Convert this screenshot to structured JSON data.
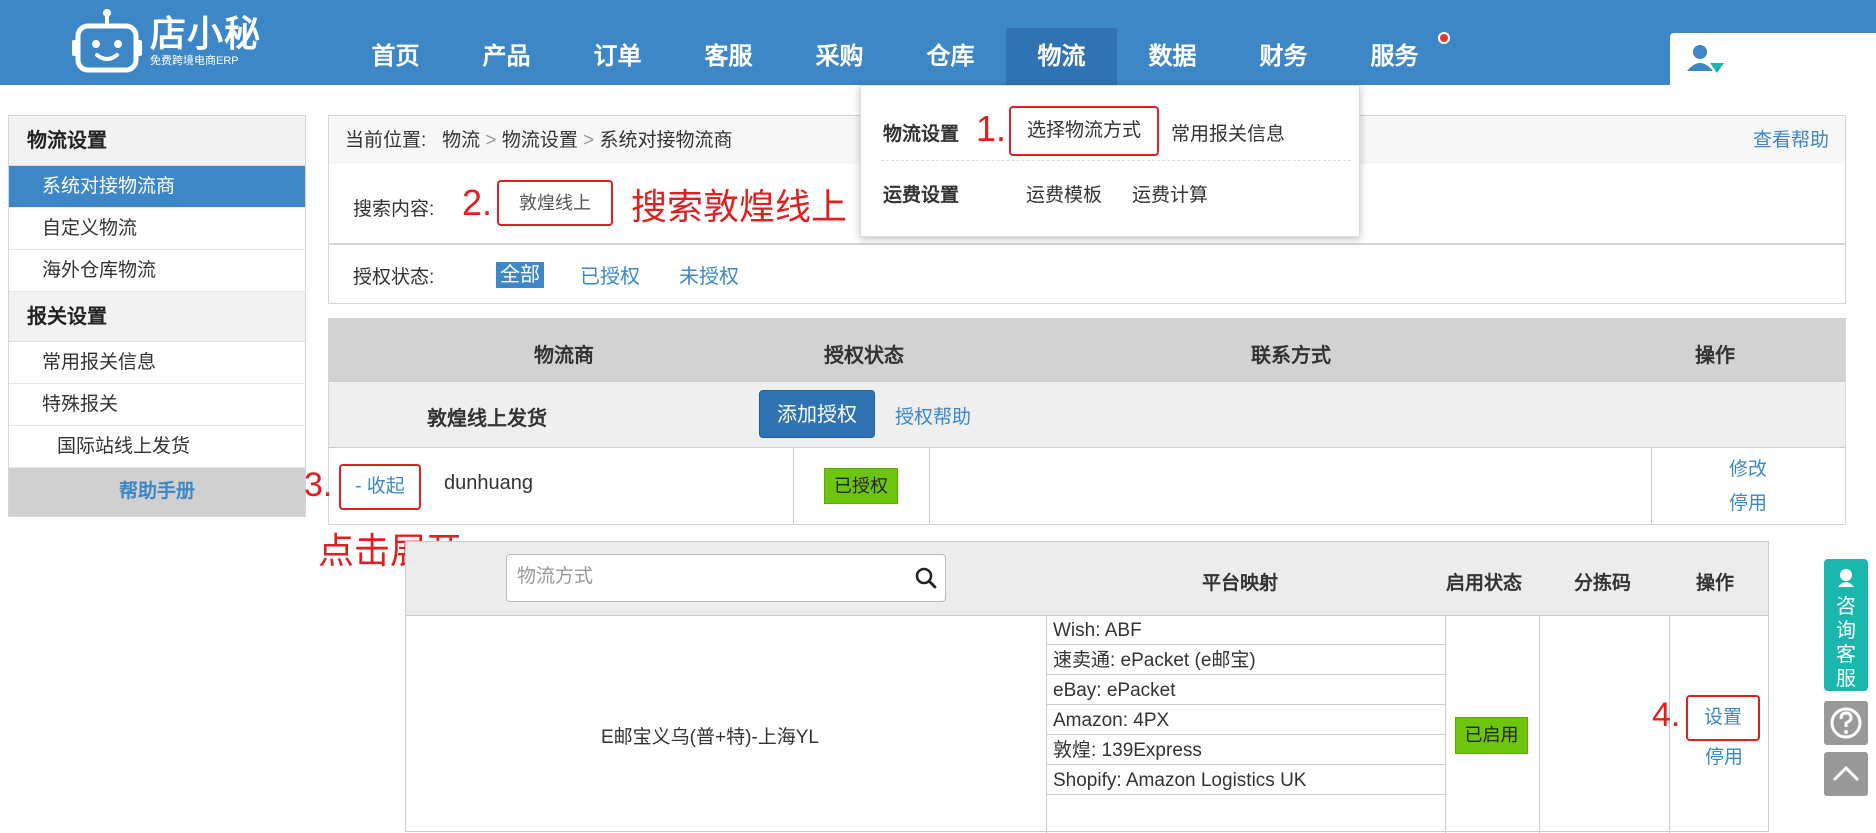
{
  "brand": {
    "name": "店小秘",
    "subtitle": "免费跨境电商ERP"
  },
  "nav": [
    {
      "label": "首页"
    },
    {
      "label": "产品"
    },
    {
      "label": "订单"
    },
    {
      "label": "客服"
    },
    {
      "label": "采购"
    },
    {
      "label": "仓库"
    },
    {
      "label": "物流"
    },
    {
      "label": "数据"
    },
    {
      "label": "财务"
    },
    {
      "label": "服务"
    }
  ],
  "sidebar": {
    "sections": [
      {
        "title": "物流设置",
        "items": [
          "系统对接物流商",
          "自定义物流",
          "海外仓库物流"
        ]
      },
      {
        "title": "报关设置",
        "items": [
          "常用报关信息",
          "特殊报关",
          "国际站线上发货"
        ]
      }
    ],
    "help": "帮助手册"
  },
  "breadcrumb": {
    "prefix": "当前位置:",
    "l1": "物流",
    "l2": "物流设置",
    "l3": "系统对接物流商",
    "sep": ">",
    "help": "查看帮助"
  },
  "search": {
    "label": "搜索内容:",
    "value": "敦煌线上"
  },
  "auth_filter": {
    "label": "授权状态:",
    "options": [
      "全部",
      "已授权",
      "未授权"
    ]
  },
  "table": {
    "headers": {
      "carrier": "物流商",
      "auth": "授权状态",
      "contact": "联系方式",
      "ops": "操作"
    },
    "group": {
      "name": "敦煌线上发货",
      "add_btn": "添加授权",
      "help_link": "授权帮助"
    },
    "row": {
      "collapse": "- 收起",
      "account": "dunhuang",
      "status": "已授权",
      "edit": "修改",
      "disable": "停用"
    }
  },
  "subtable": {
    "placeholder": "物流方式",
    "headers": {
      "mapping": "平台映射",
      "enabled": "启用状态",
      "sort_code": "分拣码",
      "ops": "操作"
    },
    "method": "E邮宝义乌(普+特)-上海YL",
    "mappings": [
      "Wish: ABF",
      "速卖通: ePacket (e邮宝)",
      "eBay: ePacket",
      "Amazon: 4PX",
      "敦煌: 139Express",
      "Shopify: Amazon Logistics UK"
    ],
    "status": "已启用",
    "set": "设置",
    "disable": "停用"
  },
  "dropdown": {
    "logistics_title": "物流设置",
    "choose_method": "选择物流方式",
    "customs_info": "常用报关信息",
    "freight_title": "运费设置",
    "freight_template": "运费模板",
    "freight_calc": "运费计算"
  },
  "annotations": {
    "n1": "1.",
    "n2": "2.",
    "search_note": "搜索敦煌线上",
    "n3": "3.",
    "expand_note": "点击展开",
    "n4": "4."
  },
  "float": {
    "service": "咨询客服"
  },
  "colors": {
    "primary": "#3d87c7",
    "highlight": "#e02020",
    "success": "#6ec50e"
  }
}
